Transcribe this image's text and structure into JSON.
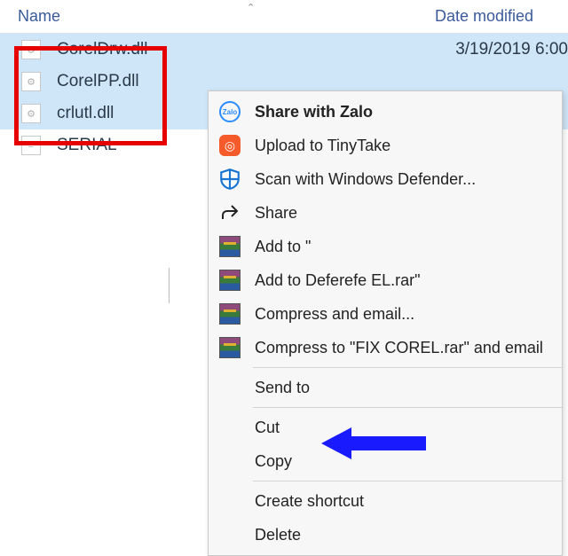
{
  "header": {
    "name_label": "Name",
    "date_label": "Date modified"
  },
  "files": [
    {
      "name": "CorelDrw.dll",
      "selected": true,
      "date": "3/19/2019 6:00"
    },
    {
      "name": "CorelPP.dll",
      "selected": true,
      "date": ""
    },
    {
      "name": "crlutl.dll",
      "selected": true,
      "date": ""
    },
    {
      "name": "SERIAL",
      "selected": false,
      "date": ""
    }
  ],
  "menu": {
    "items": [
      {
        "id": "share-zalo",
        "icon": "zalo-icon",
        "label": "Share with Zalo",
        "bold": true
      },
      {
        "id": "upload-tt",
        "icon": "tinytake-icon",
        "label": "Upload to TinyTake"
      },
      {
        "id": "scan-def",
        "icon": "defender-icon",
        "label": "Scan with Windows Defender..."
      },
      {
        "id": "share",
        "icon": "share-icon",
        "label": "Share"
      },
      {
        "id": "addto",
        "icon": "rar-icon",
        "label": "Add to \""
      },
      {
        "id": "addto-rar",
        "icon": "rar-icon",
        "label": "Add to  Deferefe EL.rar\""
      },
      {
        "id": "comp-email",
        "icon": "rar-icon",
        "label": "Compress and email..."
      },
      {
        "id": "comp-to-rar",
        "icon": "rar-icon",
        "label": "Compress to \"FIX COREL.rar\" and email"
      }
    ],
    "send_to": "Send to",
    "cut": "Cut",
    "copy": "Copy",
    "create_shortcut": "Create shortcut",
    "delete": "Delete"
  }
}
